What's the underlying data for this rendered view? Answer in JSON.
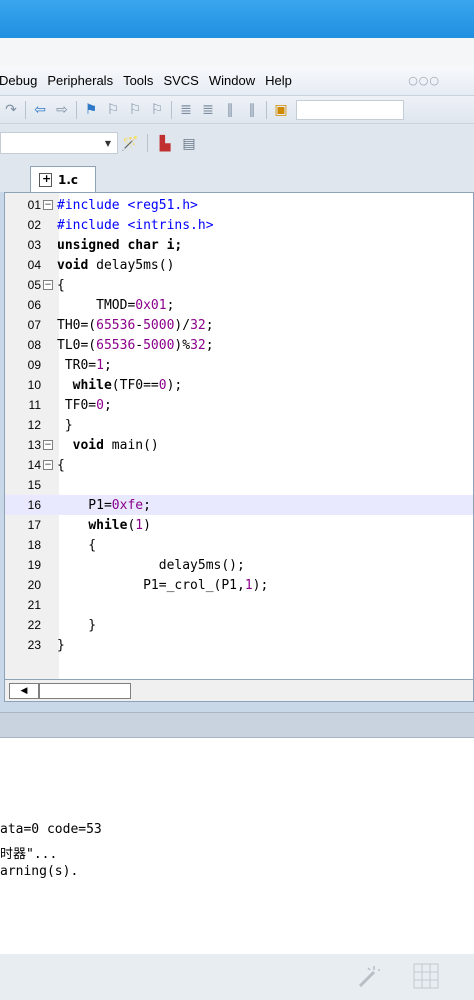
{
  "menu": {
    "items": [
      "Debug",
      "Peripherals",
      "Tools",
      "SVCS",
      "Window",
      "Help"
    ],
    "overflow": "○○○"
  },
  "editor": {
    "tab_label": "1.c",
    "lines": [
      {
        "n": "01",
        "fold": "minus",
        "text": "#include <reg51.h>",
        "cls": "pp"
      },
      {
        "n": "02",
        "fold": "",
        "text": "#include <intrins.h>",
        "cls": "pp"
      },
      {
        "n": "03",
        "fold": "",
        "text": "unsigned char i;",
        "cls": "kw"
      },
      {
        "n": "04",
        "fold": "",
        "text": "void delay5ms()",
        "cls": ""
      },
      {
        "n": "05",
        "fold": "minus",
        "text": "{",
        "cls": ""
      },
      {
        "n": "06",
        "fold": "",
        "text": "     TMOD=0x01;",
        "cls": ""
      },
      {
        "n": "07",
        "fold": "",
        "text": "TH0=(65536-5000)/32;",
        "cls": ""
      },
      {
        "n": "08",
        "fold": "",
        "text": "TL0=(65536-5000)%32;",
        "cls": ""
      },
      {
        "n": "09",
        "fold": "",
        "text": " TR0=1;",
        "cls": ""
      },
      {
        "n": "10",
        "fold": "",
        "text": "  while(TF0==0);",
        "cls": ""
      },
      {
        "n": "11",
        "fold": "",
        "text": " TF0=0;",
        "cls": ""
      },
      {
        "n": "12",
        "fold": "",
        "text": " }",
        "cls": ""
      },
      {
        "n": "13",
        "fold": "minus",
        "text": "  void main()",
        "cls": ""
      },
      {
        "n": "14",
        "fold": "minus",
        "text": "{",
        "cls": ""
      },
      {
        "n": "15",
        "fold": "",
        "text": "",
        "cls": ""
      },
      {
        "n": "16",
        "fold": "",
        "text": "    P1=0xfe;",
        "cls": "",
        "highlight": true
      },
      {
        "n": "17",
        "fold": "",
        "text": "    while(1)",
        "cls": ""
      },
      {
        "n": "18",
        "fold": "",
        "text": "    {",
        "cls": ""
      },
      {
        "n": "19",
        "fold": "",
        "text": "             delay5ms();",
        "cls": ""
      },
      {
        "n": "20",
        "fold": "",
        "text": "           P1=_crol_(P1,1);",
        "cls": ""
      },
      {
        "n": "21",
        "fold": "",
        "text": "",
        "cls": ""
      },
      {
        "n": "22",
        "fold": "",
        "text": "    }",
        "cls": ""
      },
      {
        "n": "23",
        "fold": "",
        "text": "}",
        "cls": ""
      }
    ]
  },
  "output": {
    "lines": [
      "ata=0 code=53",
      "时器\"...",
      "arning(s)."
    ]
  }
}
